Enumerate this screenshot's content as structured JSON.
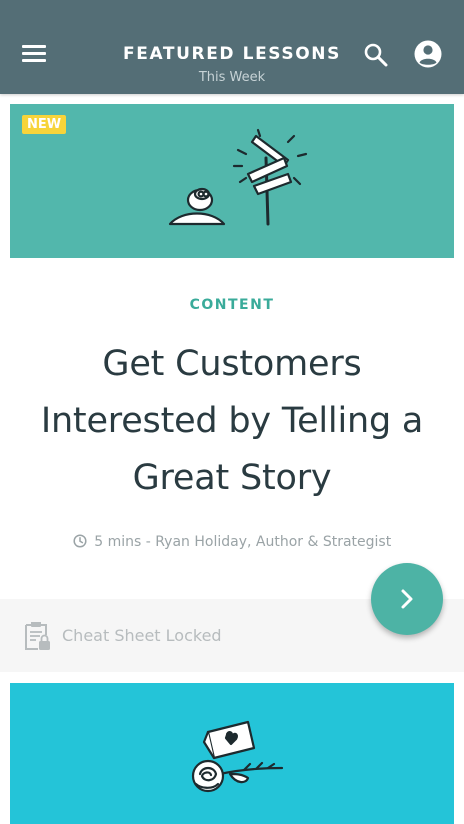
{
  "appbar": {
    "title": "FEATURED LESSONS",
    "subtitle": "This Week",
    "menu_icon": "menu-icon",
    "search_icon": "search-icon",
    "account_icon": "account-circle-icon"
  },
  "lesson": {
    "badge": "NEW",
    "category": "CONTENT",
    "title": "Get Customers Interested by Telling a Great Story",
    "meta": "5 mins - Ryan Holiday, Author & Strategist",
    "meta_icon": "clock-icon",
    "cheat_sheet": "Cheat Sheet Locked",
    "cheat_sheet_icon": "locked-clipboard-icon",
    "next_icon": "chevron-right-icon"
  },
  "colors": {
    "appbar": "#546e76",
    "card_teal": "#52b7ac",
    "card_cyan": "#24c4d8",
    "accent": "#3aab9a",
    "badge": "#f7d43a"
  }
}
